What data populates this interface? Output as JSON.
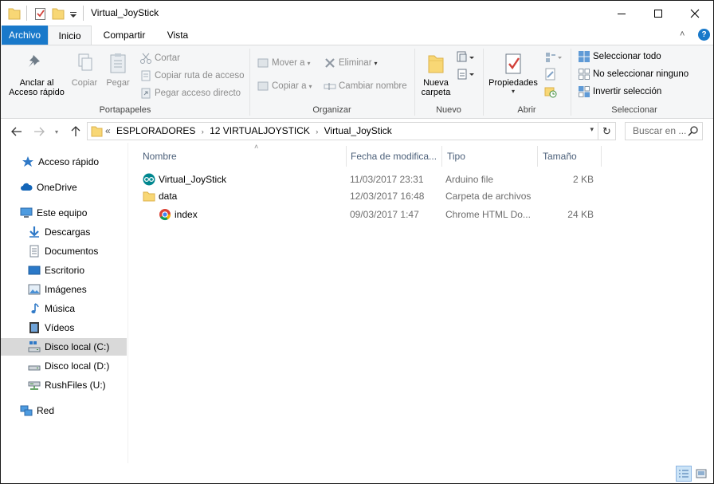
{
  "window": {
    "title": "Virtual_JoyStick",
    "controls": [
      "minimize",
      "maximize",
      "close"
    ]
  },
  "ribbon_tabs": {
    "archivo": "Archivo",
    "inicio": "Inicio",
    "compartir": "Compartir",
    "vista": "Vista"
  },
  "ribbon": {
    "portapapeles": {
      "label": "Portapapeles",
      "anclar": "Anclar al",
      "anclar2": "Acceso rápido",
      "copiar": "Copiar",
      "pegar": "Pegar",
      "cortar": "Cortar",
      "copiar_ruta": "Copiar ruta de acceso",
      "pegar_acceso": "Pegar acceso directo"
    },
    "organizar": {
      "label": "Organizar",
      "mover": "Mover a",
      "copiar_a": "Copiar a",
      "eliminar": "Eliminar",
      "cambiar_nombre": "Cambiar nombre"
    },
    "nuevo": {
      "label": "Nuevo",
      "nueva_carpeta": "Nueva",
      "nueva_carpeta2": "carpeta"
    },
    "abrir": {
      "label": "Abrir",
      "propiedades": "Propiedades"
    },
    "seleccionar": {
      "label": "Seleccionar",
      "todo": "Seleccionar todo",
      "ninguno": "No seleccionar ninguno",
      "invertir": "Invertir selección"
    }
  },
  "address": {
    "overflow": "«",
    "crumbs": [
      "ESPLORADORES",
      "12 VIRTUALJOYSTICK",
      "Virtual_JoyStick"
    ],
    "search_placeholder": "Buscar en ..."
  },
  "nav_pane": {
    "items": [
      {
        "label": "Acceso rápido",
        "icon": "star-icon"
      },
      {
        "label": "OneDrive",
        "icon": "cloud-icon"
      },
      {
        "label": "Este equipo",
        "icon": "computer-icon"
      },
      {
        "label": "Descargas",
        "icon": "download-icon"
      },
      {
        "label": "Documentos",
        "icon": "document-icon"
      },
      {
        "label": "Escritorio",
        "icon": "desktop-icon"
      },
      {
        "label": "Imágenes",
        "icon": "image-icon"
      },
      {
        "label": "Música",
        "icon": "music-icon"
      },
      {
        "label": "Vídeos",
        "icon": "video-icon"
      },
      {
        "label": "Disco local (C:)",
        "icon": "drive-c-icon",
        "selected": true
      },
      {
        "label": "Disco local (D:)",
        "icon": "drive-icon"
      },
      {
        "label": "RushFiles (U:)",
        "icon": "network-drive-icon"
      },
      {
        "label": "Red",
        "icon": "network-icon"
      }
    ]
  },
  "file_list": {
    "columns": [
      "Nombre",
      "Fecha de modifica...",
      "Tipo",
      "Tamaño"
    ],
    "rows": [
      {
        "name": "Virtual_JoyStick",
        "date": "11/03/2017 23:31",
        "type": "Arduino file",
        "size": "2 KB",
        "icon": "arduino-icon"
      },
      {
        "name": "data",
        "date": "12/03/2017 16:48",
        "type": "Carpeta de archivos",
        "size": "",
        "icon": "folder-icon"
      },
      {
        "name": "index",
        "date": "09/03/2017 1:47",
        "type": "Chrome HTML Do...",
        "size": "24 KB",
        "icon": "chrome-icon"
      }
    ]
  },
  "colors": {
    "accent": "#1979ca",
    "folder": "#f8d775",
    "selected": "#d9d9d9"
  }
}
